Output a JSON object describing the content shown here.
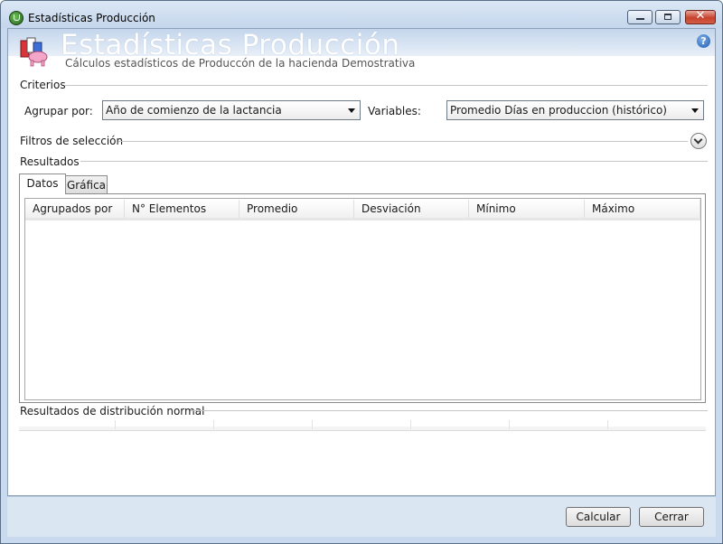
{
  "window": {
    "title": "Estadísticas Producción"
  },
  "header": {
    "big_title": "Estadísticas Producción",
    "subtitle": "Cálculos estadísticos de Produccón de la hacienda Demostrativa",
    "help_label": "?"
  },
  "criterios": {
    "section_label": "Criterios",
    "agrupar_label": "Agrupar por:",
    "agrupar_value": "Año de comienzo de la lactancia",
    "variables_label": "Variables:",
    "variables_value": "Promedio Días en produccion (histórico)"
  },
  "filtros": {
    "section_label": "Filtros de selección"
  },
  "resultados": {
    "section_label": "Resultados",
    "tabs": [
      "Datos",
      "Gráfica"
    ],
    "columns": [
      "Agrupados por",
      "N° Elementos",
      "Promedio",
      "Desviación",
      "Mínimo",
      "Máximo"
    ]
  },
  "distribucion": {
    "section_label": "Resultados de distribución normal"
  },
  "footer": {
    "calcular_label": "Calcular",
    "cerrar_label": "Cerrar"
  },
  "colors": {
    "title_bar": "#c4d6ec",
    "close_button": "#c6422e",
    "footer": "#dbe6f3"
  }
}
